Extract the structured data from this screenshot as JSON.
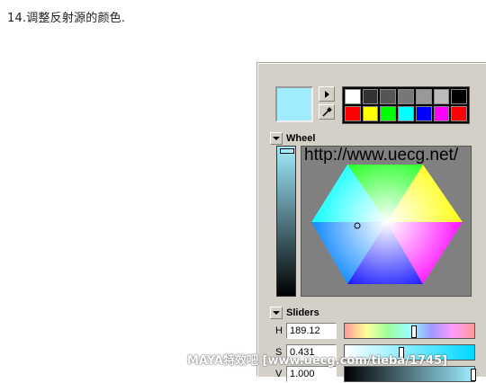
{
  "caption": "14.调整反射源的颜色.",
  "color_editor": {
    "current_color": "#a0ecff",
    "palette": [
      "#ffffff",
      "#333333",
      "#555555",
      "#777777",
      "#999999",
      "#bbbbbb",
      "#000000",
      "#ff0000",
      "#ffff00",
      "#00ff00",
      "#00ffff",
      "#0000ff",
      "#ff00ff",
      "#ff0000"
    ],
    "wheel_section": {
      "label": "Wheel",
      "watermark_url": "http://www.uecg.net/"
    },
    "sliders_section": {
      "label": "Sliders",
      "rows": [
        {
          "channel": "H",
          "value": "189.12",
          "level": 0.53
        },
        {
          "channel": "S",
          "value": "0.431",
          "level": 0.43
        },
        {
          "channel": "V",
          "value": "1.000",
          "level": 1.0
        }
      ]
    }
  },
  "watermark": "MAYA特效吧 [www.uecg.com/tieba/1745]"
}
